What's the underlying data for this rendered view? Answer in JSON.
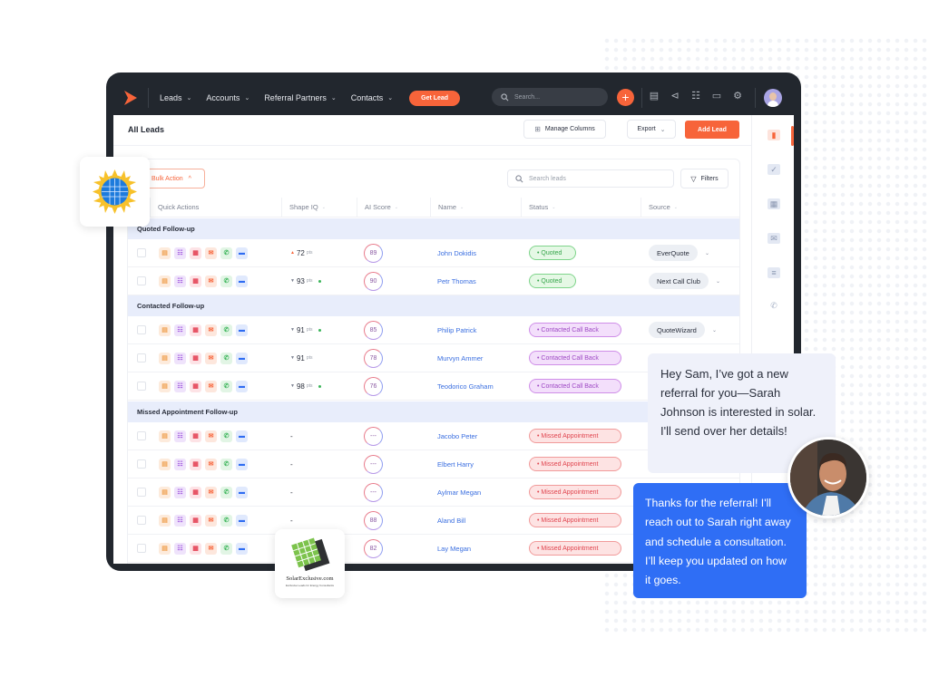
{
  "topbar": {
    "nav": [
      {
        "label": "Leads"
      },
      {
        "label": "Accounts"
      },
      {
        "label": "Referral Partners"
      },
      {
        "label": "Contacts"
      }
    ],
    "get_lead": "Get Lead",
    "search_placeholder": "Search...",
    "icons": [
      "report-icon",
      "megaphone-icon",
      "checklist-icon",
      "monitor-icon",
      "settings-icon"
    ]
  },
  "page": {
    "title": "All Leads",
    "manage_columns": "Manage Columns",
    "export": "Export",
    "add_lead": "Add Lead",
    "bulk_action": "Bulk Action",
    "search_leads_placeholder": "Search leads",
    "filters": "Filters"
  },
  "table": {
    "columns": [
      "Quick Actions",
      "Shape IQ",
      "AI Score",
      "Name",
      "Status",
      "Source"
    ],
    "groups": [
      {
        "label": "Quoted Follow-up"
      },
      {
        "label": "Contacted Follow-up"
      },
      {
        "label": "Missed Appointment Follow-up"
      }
    ],
    "rows": [
      {
        "shape": "72",
        "trend": "up",
        "active": false,
        "score": "89",
        "name": "John Dokidis",
        "status": "Quoted",
        "source": "EverQuote"
      },
      {
        "shape": "93",
        "trend": "down",
        "active": true,
        "score": "90",
        "name": "Petr Thomas",
        "status": "Quoted",
        "source": "Next Call Club"
      },
      {
        "shape": "91",
        "trend": "down",
        "active": true,
        "score": "85",
        "name": "Philip Patrick",
        "status": "Contacted Call Back",
        "source": "QuoteWizard"
      },
      {
        "shape": "91",
        "trend": "down",
        "active": false,
        "score": "78",
        "name": "Murvyn Ammer",
        "status": "Contacted Call Back",
        "source": ""
      },
      {
        "shape": "98",
        "trend": "down",
        "active": true,
        "score": "76",
        "name": "Teodorico Graham",
        "status": "Contacted Call Back",
        "source": ""
      },
      {
        "shape": "-",
        "score": "---",
        "name": "Jacobo Peter",
        "status": "Missed Appointment",
        "source": ""
      },
      {
        "shape": "-",
        "score": "---",
        "name": "Elbert Harry",
        "status": "Missed Appointment",
        "source": ""
      },
      {
        "shape": "-",
        "score": "---",
        "name": "Aylmar Megan",
        "status": "Missed Appointment",
        "source": ""
      },
      {
        "shape": "-",
        "score": "88",
        "name": "Aland Bill",
        "status": "Missed Appointment",
        "source": ""
      },
      {
        "shape": "-",
        "score": "82",
        "name": "Lay Megan",
        "status": "Missed Appointment",
        "source": ""
      }
    ],
    "pts_label": "pts"
  },
  "rail": [
    "analytics-icon",
    "tasks-icon",
    "calendar-icon",
    "mail-icon",
    "chat-icon",
    "phone-icon"
  ],
  "partner_logo": {
    "name": "SolarExclusive.com",
    "tagline": "Exclusive Leads for Energy Consultants"
  },
  "chat": {
    "incoming": "Hey Sam, I’ve got a new referral for you—Sarah Johnson is interested in solar. I'll send over her details!",
    "outgoing": "Thanks for the referral! I'll reach out to Sarah right away and schedule a consultation. I’ll keep you updated on how it goes."
  },
  "colors": {
    "accent": "#f7643a",
    "chat_blue": "#2f6ef5",
    "dark": "#22272e"
  }
}
